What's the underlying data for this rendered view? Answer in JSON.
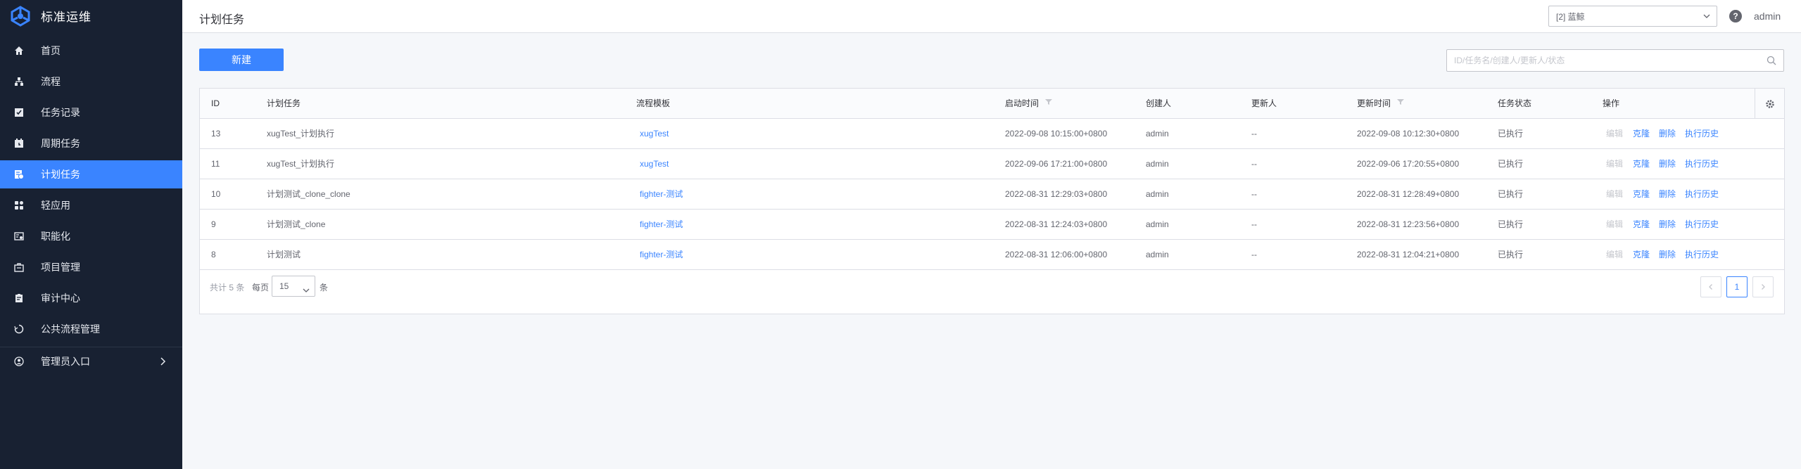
{
  "app": {
    "title": "标准运维",
    "brand_color": "#3a84ff",
    "sidebar_bg": "#182132"
  },
  "sidebar": {
    "items": [
      {
        "label": "首页",
        "icon": "home-icon"
      },
      {
        "label": "流程",
        "icon": "flow-icon"
      },
      {
        "label": "任务记录",
        "icon": "task-record-icon"
      },
      {
        "label": "周期任务",
        "icon": "periodic-task-icon"
      },
      {
        "label": "计划任务",
        "icon": "scheduled-task-icon",
        "active": true
      },
      {
        "label": "轻应用",
        "icon": "light-app-icon"
      },
      {
        "label": "职能化",
        "icon": "functional-icon"
      },
      {
        "label": "项目管理",
        "icon": "project-management-icon"
      },
      {
        "label": "审计中心",
        "icon": "audit-icon"
      },
      {
        "label": "公共流程管理",
        "icon": "common-flow-icon"
      },
      {
        "label": "管理员入口",
        "icon": "admin-icon",
        "has_children": true
      }
    ]
  },
  "header": {
    "title": "计划任务",
    "project": "[2] 蓝鲸",
    "help": "?",
    "user": "admin"
  },
  "toolbar": {
    "new_label": "新建",
    "search_placeholder": "ID/任务名/创建人/更新人/状态"
  },
  "table": {
    "columns": {
      "id": "ID",
      "name": "计划任务",
      "template": "流程模板",
      "start_time": "启动时间",
      "creator": "创建人",
      "editor": "更新人",
      "update_time": "更新时间",
      "status": "任务状态",
      "operation": "操作"
    },
    "rows": [
      {
        "id": "13",
        "name": "xugTest_计划执行",
        "template": "xugTest",
        "start_time": "2022-09-08 10:15:00+0800",
        "creator": "admin",
        "editor": "--",
        "update_time": "2022-09-08 10:12:30+0800",
        "status": "已执行"
      },
      {
        "id": "11",
        "name": "xugTest_计划执行",
        "template": "xugTest",
        "start_time": "2022-09-06 17:21:00+0800",
        "creator": "admin",
        "editor": "--",
        "update_time": "2022-09-06 17:20:55+0800",
        "status": "已执行"
      },
      {
        "id": "10",
        "name": "计划测试_clone_clone",
        "template": "fighter-测试",
        "start_time": "2022-08-31 12:29:03+0800",
        "creator": "admin",
        "editor": "--",
        "update_time": "2022-08-31 12:28:49+0800",
        "status": "已执行"
      },
      {
        "id": "9",
        "name": "计划测试_clone",
        "template": "fighter-测试",
        "start_time": "2022-08-31 12:24:03+0800",
        "creator": "admin",
        "editor": "--",
        "update_time": "2022-08-31 12:23:56+0800",
        "status": "已执行"
      },
      {
        "id": "8",
        "name": "计划测试",
        "template": "fighter-测试",
        "start_time": "2022-08-31 12:06:00+0800",
        "creator": "admin",
        "editor": "--",
        "update_time": "2022-08-31 12:04:21+0800",
        "status": "已执行"
      }
    ],
    "operations": {
      "edit": "编辑",
      "clone": "克隆",
      "delete": "删除",
      "history": "执行历史"
    }
  },
  "pagination": {
    "total_text": "共计 5 条",
    "per_page_label": "每页",
    "per_page_value": "15",
    "per_page_unit": "条",
    "current_page": "1"
  }
}
